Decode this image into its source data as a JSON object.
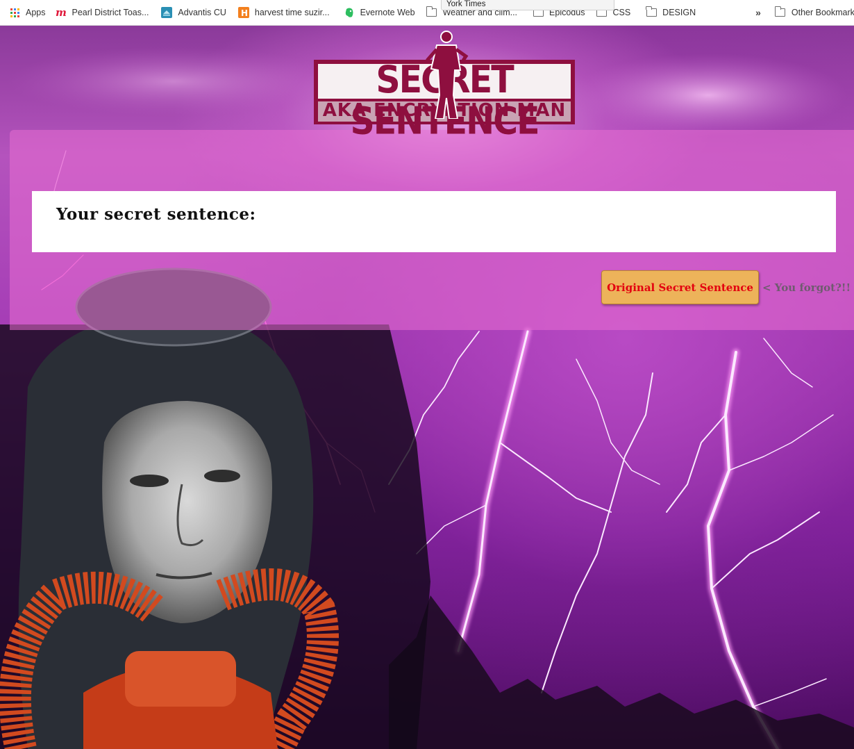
{
  "bookmarks": {
    "items": [
      {
        "label": "Apps",
        "icon": "apps-grid-icon"
      },
      {
        "label": "Pearl District Toas...",
        "icon": "meetup-icon"
      },
      {
        "label": "Advantis CU",
        "icon": "advantis-icon"
      },
      {
        "label": "harvest time suzir...",
        "icon": "h-icon"
      },
      {
        "label": "Evernote Web",
        "icon": "evernote-icon"
      },
      {
        "label": "Weather and clim...",
        "icon": "folder-icon"
      },
      {
        "label": "Epicodus",
        "icon": "folder-icon"
      },
      {
        "label": "CSS",
        "icon": "folder-icon"
      },
      {
        "label": "DESIGN",
        "icon": "folder-icon"
      }
    ],
    "overflow": "»",
    "other": "Other Bookmarks",
    "tooltip": "York Times"
  },
  "logo": {
    "title": "SECRET SENTENCE",
    "subtitle": "AKA ENCRYPTION MAN",
    "colors": {
      "maroon": "#8e0f3f",
      "pink": "#c9a3b4"
    }
  },
  "result": {
    "label": "Your secret sentence:"
  },
  "actions": {
    "original_button": "Original Secret Sentence",
    "hint": "< You forgot?!!"
  },
  "colors": {
    "button_bg": "#edb35a",
    "button_text": "#e3000f",
    "panel": "#e86ed2"
  }
}
